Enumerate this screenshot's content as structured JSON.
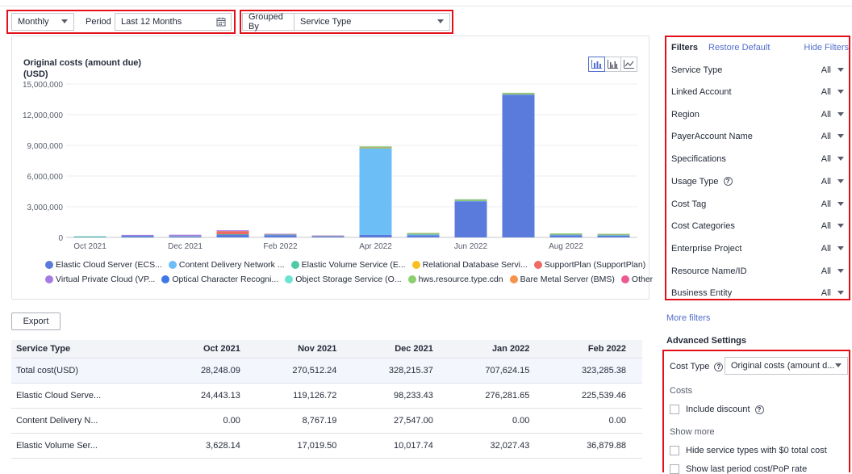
{
  "toolbar": {
    "granularity": "Monthly",
    "period_label": "Period",
    "period_value": "Last 12 Months",
    "grouped_by_label": "Grouped By",
    "grouped_by_value": "Service Type"
  },
  "chart": {
    "title": "Original costs (amount due)",
    "unit": "(USD)",
    "view_buttons": [
      "stacked-bar-chart-icon",
      "bar-chart-icon",
      "line-chart-icon"
    ]
  },
  "chart_data": {
    "type": "bar",
    "stacked": true,
    "title": "Original costs (amount due)",
    "ylabel": "(USD)",
    "ylim": [
      0,
      15000000
    ],
    "yticks": [
      "0",
      "3,000,000",
      "6,000,000",
      "9,000,000",
      "12,000,000",
      "15,000,000"
    ],
    "x_tick_labels": [
      "Oct 2021",
      "Dec 2021",
      "Feb 2022",
      "Apr 2022",
      "Jun 2022",
      "Aug 2022"
    ],
    "categories": [
      "Oct 2021",
      "Nov 2021",
      "Dec 2021",
      "Jan 2022",
      "Feb 2022",
      "Mar 2022",
      "Apr 2022",
      "May 2022",
      "Jun 2022",
      "Jul 2022",
      "Aug 2022",
      "Sep 2022"
    ],
    "series": [
      {
        "name": "Elastic Cloud Server (ECS...",
        "color": "#5b7bdc",
        "values": [
          24443,
          119127,
          98233,
          276282,
          225539,
          60000,
          240000,
          220000,
          3520000,
          13950000,
          200000,
          170000
        ]
      },
      {
        "name": "Content Delivery Network ...",
        "color": "#6cbef7",
        "values": [
          0,
          8767,
          27547,
          0,
          0,
          20000,
          8450000,
          50000,
          30000,
          20000,
          30000,
          20000
        ]
      },
      {
        "name": "Elastic Volume Service (E...",
        "color": "#4dc9a6",
        "values": [
          3628,
          17020,
          10018,
          32027,
          36880,
          20000,
          40000,
          40000,
          50000,
          40000,
          40000,
          40000
        ]
      },
      {
        "name": "Relational Database Servi...",
        "color": "#f9c020",
        "values": [
          0,
          0,
          5000,
          10000,
          10000,
          5000,
          60000,
          30000,
          30000,
          30000,
          20000,
          20000
        ]
      },
      {
        "name": "SupportPlan (SupportPlan)",
        "color": "#ee6c63",
        "values": [
          0,
          0,
          0,
          300000,
          0,
          0,
          0,
          0,
          0,
          0,
          0,
          0
        ]
      },
      {
        "name": "Virtual Private Cloud (VP...",
        "color": "#a57ae3",
        "values": [
          0,
          100000,
          120000,
          60000,
          30000,
          20000,
          30000,
          20000,
          20000,
          20000,
          20000,
          20000
        ]
      },
      {
        "name": "Optical Character Recogni...",
        "color": "#3e77e6",
        "values": [
          0,
          0,
          0,
          0,
          0,
          0,
          0,
          0,
          0,
          0,
          0,
          0
        ]
      },
      {
        "name": "Object Storage Service (O...",
        "color": "#6ae3d0",
        "values": [
          0,
          0,
          0,
          0,
          0,
          0,
          0,
          0,
          0,
          0,
          0,
          0
        ]
      },
      {
        "name": "hws.resource.type.cdn",
        "color": "#8ccf6e",
        "values": [
          0,
          0,
          0,
          0,
          0,
          0,
          60000,
          50000,
          40000,
          50000,
          80000,
          60000
        ]
      },
      {
        "name": "Bare Metal Server (BMS)",
        "color": "#f5934c",
        "values": [
          0,
          0,
          0,
          0,
          0,
          0,
          0,
          0,
          0,
          0,
          0,
          0
        ]
      },
      {
        "name": "Other",
        "color": "#ec5b8f",
        "values": [
          0,
          0,
          0,
          0,
          0,
          0,
          0,
          0,
          0,
          0,
          0,
          0
        ]
      }
    ]
  },
  "table": {
    "export_label": "Export",
    "columns": [
      "Service Type",
      "Oct 2021",
      "Nov 2021",
      "Dec 2021",
      "Jan 2022",
      "Feb 2022"
    ],
    "rows": [
      [
        "Total cost(USD)",
        "28,248.09",
        "270,512.24",
        "328,215.37",
        "707,624.15",
        "323,285.38"
      ],
      [
        "Elastic Cloud Serve...",
        "24,443.13",
        "119,126.72",
        "98,233.43",
        "276,281.65",
        "225,539.46"
      ],
      [
        "Content Delivery N...",
        "0.00",
        "8,767.19",
        "27,547.00",
        "0.00",
        "0.00"
      ],
      [
        "Elastic Volume Ser...",
        "3,628.14",
        "17,019.50",
        "10,017.74",
        "32,027.43",
        "36,879.88"
      ]
    ]
  },
  "filters": {
    "title": "Filters",
    "restore_label": "Restore Default",
    "hide_label": "Hide Filters",
    "items": [
      {
        "label": "Service Type",
        "value": "All"
      },
      {
        "label": "Linked Account",
        "value": "All"
      },
      {
        "label": "Region",
        "value": "All"
      },
      {
        "label": "PayerAccount Name",
        "value": "All"
      },
      {
        "label": "Specifications",
        "value": "All"
      },
      {
        "label": "Usage Type",
        "value": "All"
      },
      {
        "label": "Cost Tag",
        "value": "All"
      },
      {
        "label": "Cost Categories",
        "value": "All"
      },
      {
        "label": "Enterprise Project",
        "value": "All"
      },
      {
        "label": "Resource Name/ID",
        "value": "All"
      },
      {
        "label": "Business Entity",
        "value": "All"
      }
    ],
    "more_label": "More filters"
  },
  "advanced": {
    "title": "Advanced Settings",
    "cost_type_label": "Cost Type",
    "cost_type_value": "Original costs (amount d...",
    "costs_label": "Costs",
    "include_discount": "Include discount",
    "show_more": "Show more",
    "hide_zero": "Hide service types with $0 total cost",
    "show_last_period": "Show last period cost/PoP rate"
  },
  "colors": {
    "accent": "#526ecc",
    "highlight_border": "#e3101a"
  }
}
